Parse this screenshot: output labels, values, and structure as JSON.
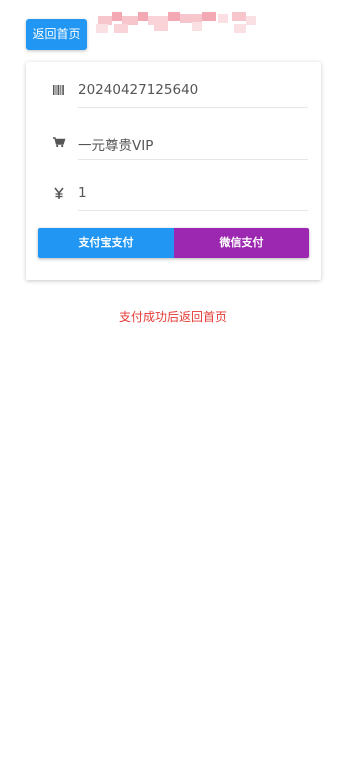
{
  "header": {
    "home_label": "返回首页"
  },
  "order": {
    "order_id": "20240427125640",
    "product": "一元尊贵VIP",
    "amount": "1",
    "icons": {
      "order_id": "barcode-icon",
      "product": "cart-icon",
      "amount": "yuan-icon"
    }
  },
  "payment": {
    "alipay_label": "支付宝支付",
    "wechat_label": "微信支付"
  },
  "notice": "支付成功后返回首页",
  "colors": {
    "primary": "#2196f3",
    "wechat": "#9c27b0",
    "notice": "#e53935",
    "text": "#555555"
  }
}
